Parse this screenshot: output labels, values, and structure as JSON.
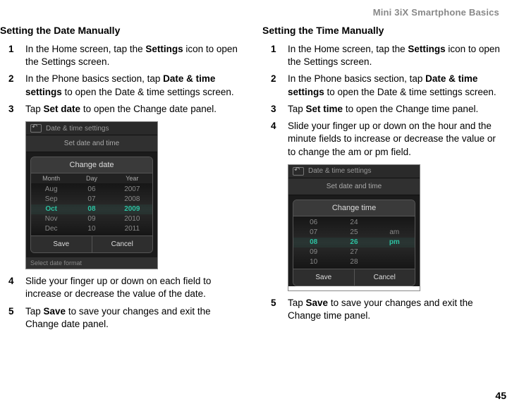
{
  "doc_header": "Mini 3iX Smartphone Basics",
  "page_number": "45",
  "left": {
    "title": "Setting the Date Manually",
    "steps": {
      "s1_num": "1",
      "s1_a": "In the Home screen, tap the ",
      "s1_b": "Settings",
      "s1_c": " icon to open the Settings screen.",
      "s2_num": "2",
      "s2_a": "In the Phone basics section, tap ",
      "s2_b": "Date & time settings",
      "s2_c": " to open the Date & time settings screen.",
      "s3_num": "3",
      "s3_a": "Tap ",
      "s3_b": "Set date",
      "s3_c": " to open the Change date panel.",
      "s4_num": "4",
      "s4_txt": "Slide your finger up or down on each field to increase or decrease the value of the date.",
      "s5_num": "5",
      "s5_a": "Tap ",
      "s5_b": "Save",
      "s5_c": " to save your changes and exit the Change date panel."
    },
    "phone": {
      "top": "Date & time settings",
      "sub": "Set date and time",
      "modal_title": "Change date",
      "h1": "Month",
      "h2": "Day",
      "h3": "Year",
      "m": [
        "Aug",
        "Sep",
        "Oct",
        "Nov",
        "Dec"
      ],
      "d": [
        "06",
        "07",
        "08",
        "09",
        "10"
      ],
      "y": [
        "2007",
        "2008",
        "2009",
        "2010",
        "2011"
      ],
      "save": "Save",
      "cancel": "Cancel",
      "footer": "Select date format"
    }
  },
  "right": {
    "title": "Setting the Time Manually",
    "steps": {
      "s1_num": "1",
      "s1_a": "In the Home screen, tap the ",
      "s1_b": "Settings",
      "s1_c": " icon to open the Settings screen.",
      "s2_num": "2",
      "s2_a": "In the Phone basics section, tap ",
      "s2_b": "Date & time settings",
      "s2_c": " to open the Date & time settings screen.",
      "s3_num": "3",
      "s3_a": "Tap ",
      "s3_b": "Set time",
      "s3_c": " to open the Change time panel.",
      "s4_num": "4",
      "s4_txt": "Slide your finger up or down on the hour and the minute fields to increase or decrease the value or to change the am or pm field.",
      "s5_num": "5",
      "s5_a": "Tap ",
      "s5_b": "Save",
      "s5_c": " to save your changes and exit the Change time panel."
    },
    "phone": {
      "top": "Date & time settings",
      "sub": "Set date and time",
      "modal_title": "Change time",
      "hcol": [
        "06",
        "07",
        "08",
        "09",
        "10"
      ],
      "mcol": [
        "24",
        "25",
        "26",
        "27",
        "28"
      ],
      "ap": [
        "am",
        "pm"
      ],
      "save": "Save",
      "cancel": "Cancel"
    }
  }
}
